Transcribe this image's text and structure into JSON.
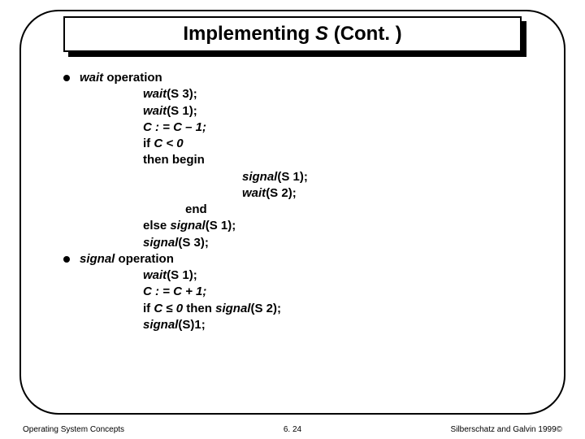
{
  "title": {
    "pre": "Implementing ",
    "ital": "S",
    "post": " (Cont. )"
  },
  "bullets": [
    {
      "label_italic": "wait",
      "label_rest": " operation"
    },
    {
      "label_italic": "signal",
      "label_rest": " operation"
    }
  ],
  "wait_lines": {
    "l1_i": "wait",
    "l1_r": "(S 3);",
    "l2_i": "wait",
    "l2_r": "(S 1);",
    "l3": "C : = C – 1;",
    "l4_a": "if ",
    "l4_b": "C < 0",
    "l5": "then begin",
    "l6_i": "signal",
    "l6_r": "(S 1);",
    "l7_i": "wait",
    "l7_r": "(S 2);",
    "l8": "end",
    "l9_a": "else ",
    "l9_i": "signal",
    "l9_r": "(S 1);",
    "l10_i": "signal",
    "l10_r": "(S 3);"
  },
  "signal_lines": {
    "l1_i": "wait",
    "l1_r": "(S 1);",
    "l2": "C : = C + 1;",
    "l3_a": "if ",
    "l3_b": "C ",
    "l3_sym": "≤",
    "l3_c": " 0 ",
    "l3_d": "then ",
    "l3_i": "signal",
    "l3_r": "(S 2);",
    "l4_i": "signal",
    "l4_r": "(S)1;"
  },
  "footer": {
    "left": "Operating System Concepts",
    "center": "6. 24",
    "right": "Silberschatz and Galvin 1999",
    "copy": "©"
  }
}
